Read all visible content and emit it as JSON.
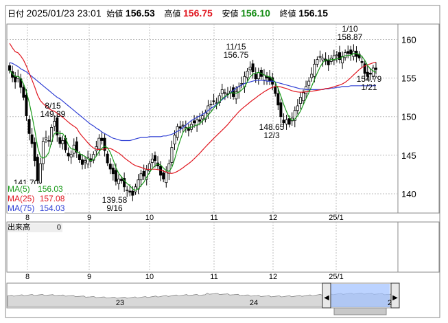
{
  "header": {
    "date_label": "日付",
    "datetime": "2025/01/23 23:01",
    "open_label": "始値",
    "open": "156.53",
    "high_label": "高値",
    "high": "156.75",
    "low_label": "安値",
    "low": "156.10",
    "close_label": "終値",
    "close": "156.15"
  },
  "ma_legend": [
    {
      "label": "MA(5)",
      "value": "156.03",
      "color": "#1a9a1a"
    },
    {
      "label": "MA(25)",
      "value": "157.08",
      "color": "#e0161f"
    },
    {
      "label": "MA(75)",
      "value": "154.03",
      "color": "#2f3fd4"
    }
  ],
  "volume": {
    "label": "出来高",
    "value": "0"
  },
  "colors": {
    "up": "#ffffff",
    "down": "#000000",
    "ma5": "#1a9a1a",
    "ma25": "#e0161f",
    "ma75": "#2f3fd4",
    "grid": "#bdbdbd",
    "nav_fill": "#9fc0ff"
  },
  "chart_data": {
    "type": "candlestick",
    "title": "",
    "y_ticks": [
      140,
      145,
      150,
      155,
      160
    ],
    "ylim": [
      137.5,
      162
    ],
    "x_month_labels": [
      "8",
      "9",
      "10",
      "11",
      "12",
      "25/1"
    ],
    "annotations": [
      {
        "price": "141.70",
        "date": ""
      },
      {
        "price": "149.39",
        "date": "8/15"
      },
      {
        "price": "139.58",
        "date": "9/16"
      },
      {
        "price": "156.75",
        "date": "11/15"
      },
      {
        "price": "148.65",
        "date": "12/3"
      },
      {
        "price": "158.87",
        "date": "1/10"
      },
      {
        "price": "154.79",
        "date": "1/21"
      }
    ],
    "close_series": [
      156.0,
      155.1,
      154.5,
      155.2,
      153.8,
      152.5,
      150.1,
      147.8,
      146.5,
      144.3,
      141.7,
      143.9,
      146.8,
      147.3,
      146.9,
      148.6,
      149.4,
      147.6,
      146.5,
      146.9,
      145.7,
      144.9,
      145.1,
      146.3,
      145.4,
      144.4,
      143.8,
      144.3,
      144.7,
      144.2,
      145.1,
      146.1,
      147.2,
      146.9,
      145.6,
      144.0,
      143.2,
      142.6,
      141.6,
      141.9,
      141.7,
      140.9,
      140.5,
      140.2,
      139.8,
      140.9,
      141.8,
      142.6,
      142.3,
      143.1,
      143.9,
      144.5,
      144.3,
      143.6,
      142.4,
      141.9,
      142.8,
      143.9,
      146.0,
      147.6,
      148.7,
      148.5,
      148.9,
      148.6,
      148.2,
      149.0,
      149.2,
      149.6,
      149.4,
      150.1,
      150.5,
      151.4,
      151.6,
      152.0,
      151.8,
      152.7,
      153.5,
      153.1,
      152.9,
      153.3,
      152.6,
      153.2,
      153.9,
      154.3,
      155.2,
      155.9,
      156.4,
      155.8,
      154.9,
      155.7,
      155.2,
      155.4,
      155.0,
      154.6,
      154.2,
      153.0,
      151.5,
      150.0,
      149.2,
      149.6,
      149.0,
      149.8,
      150.8,
      151.4,
      152.5,
      153.1,
      153.9,
      154.6,
      155.5,
      156.8,
      157.4,
      157.8,
      157.6,
      157.2,
      156.7,
      157.6,
      157.9,
      158.0,
      157.4,
      157.8,
      158.3,
      158.2,
      158.1,
      158.5,
      157.8,
      157.6,
      157.0,
      155.6,
      155.2,
      155.5,
      156.3,
      156.1
    ],
    "ma75_series": [
      157.0,
      156.9,
      156.7,
      156.5,
      156.2,
      156.0,
      155.8,
      155.5,
      155.2,
      154.9,
      154.6,
      154.3,
      154.0,
      153.7,
      153.4,
      153.1,
      152.8,
      152.5,
      152.3,
      152.0,
      151.7,
      151.4,
      151.1,
      150.8,
      150.5,
      150.2,
      149.9,
      149.6,
      149.3,
      149.0,
      148.8,
      148.5,
      148.3,
      148.0,
      147.8,
      147.6,
      147.4,
      147.2,
      147.1,
      147.0,
      146.9,
      146.9,
      146.9,
      146.9,
      147.0,
      147.1,
      147.2,
      147.3,
      147.3,
      147.3,
      147.4,
      147.4,
      147.4,
      147.4,
      147.4,
      147.5,
      147.5,
      147.6,
      147.7,
      147.9,
      148.1,
      148.3,
      148.6,
      148.9,
      149.2,
      149.5,
      149.7,
      149.9,
      150.1,
      150.3,
      150.5,
      150.8,
      151.1,
      151.3,
      151.6,
      151.9,
      152.2,
      152.5,
      152.8,
      153.1,
      153.4,
      153.7,
      153.9,
      154.1,
      154.3,
      154.4,
      154.5,
      154.6,
      154.7,
      154.7,
      154.7,
      154.7,
      154.6,
      154.6,
      154.6,
      154.5,
      154.4,
      154.3,
      154.2,
      154.1,
      154.0,
      153.9,
      153.8,
      153.7,
      153.6,
      153.6,
      153.5,
      153.5,
      153.5,
      153.5,
      153.5,
      153.5,
      153.5,
      153.6,
      153.6,
      153.7,
      153.7,
      153.8,
      153.8,
      153.9,
      153.9,
      153.9,
      154.0,
      154.0,
      154.0,
      154.0,
      154.0,
      154.0,
      154.0,
      154.0,
      154.0,
      154.03
    ]
  },
  "navigator": {
    "labels": [
      "23",
      "24",
      "2"
    ]
  }
}
